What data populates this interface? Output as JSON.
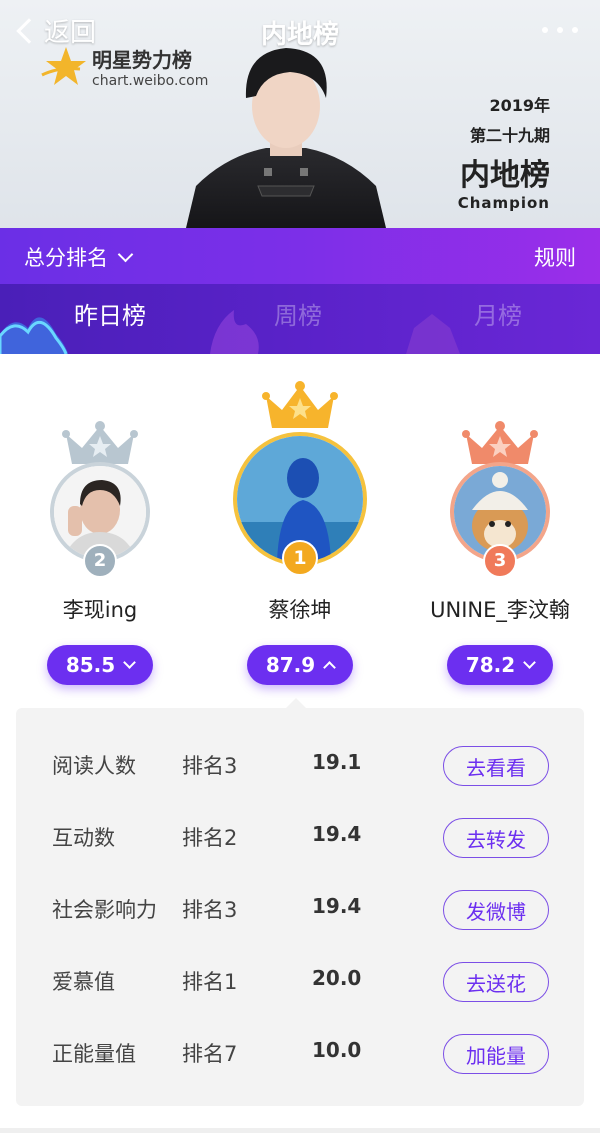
{
  "nav": {
    "back_label": "返回",
    "title": "内地榜",
    "more_icon": "more-dots-icon"
  },
  "logo": {
    "name": "明星势力榜",
    "url": "chart.weibo.com"
  },
  "champion": {
    "year": "2019年",
    "period": "第二十九期",
    "board": "内地榜",
    "label": "Champion"
  },
  "sort": {
    "label": "总分排名",
    "rules_label": "规则"
  },
  "tabs": [
    {
      "label": "昨日榜",
      "active": true
    },
    {
      "label": "周榜",
      "active": false
    },
    {
      "label": "月榜",
      "active": false
    }
  ],
  "podium": [
    {
      "rank": "2",
      "name": "李现ing",
      "score": "85.5",
      "expanded": false,
      "crown_color": "#aebdc8",
      "medal_color": "#9fb0bc"
    },
    {
      "rank": "1",
      "name": "蔡徐坤",
      "score": "87.9",
      "expanded": true,
      "crown_color": "#f7b42c",
      "medal_color": "#f3a91f"
    },
    {
      "rank": "3",
      "name": "UNINE_李汶翰",
      "score": "78.2",
      "expanded": false,
      "crown_color": "#f08a6a",
      "medal_color": "#f07a5a"
    }
  ],
  "details": [
    {
      "metric": "阅读人数",
      "rank": "排名3",
      "value": "19.1",
      "action": "去看看"
    },
    {
      "metric": "互动数",
      "rank": "排名2",
      "value": "19.4",
      "action": "去转发"
    },
    {
      "metric": "社会影响力",
      "rank": "排名3",
      "value": "19.4",
      "action": "发微博"
    },
    {
      "metric": "爱慕值",
      "rank": "排名1",
      "value": "20.0",
      "action": "去送花"
    },
    {
      "metric": "正能量值",
      "rank": "排名7",
      "value": "10.0",
      "action": "加能量"
    }
  ],
  "colors": {
    "accent": "#6c2ff0",
    "band_start": "#6b2fe6",
    "band_end": "#9b2ee9"
  }
}
